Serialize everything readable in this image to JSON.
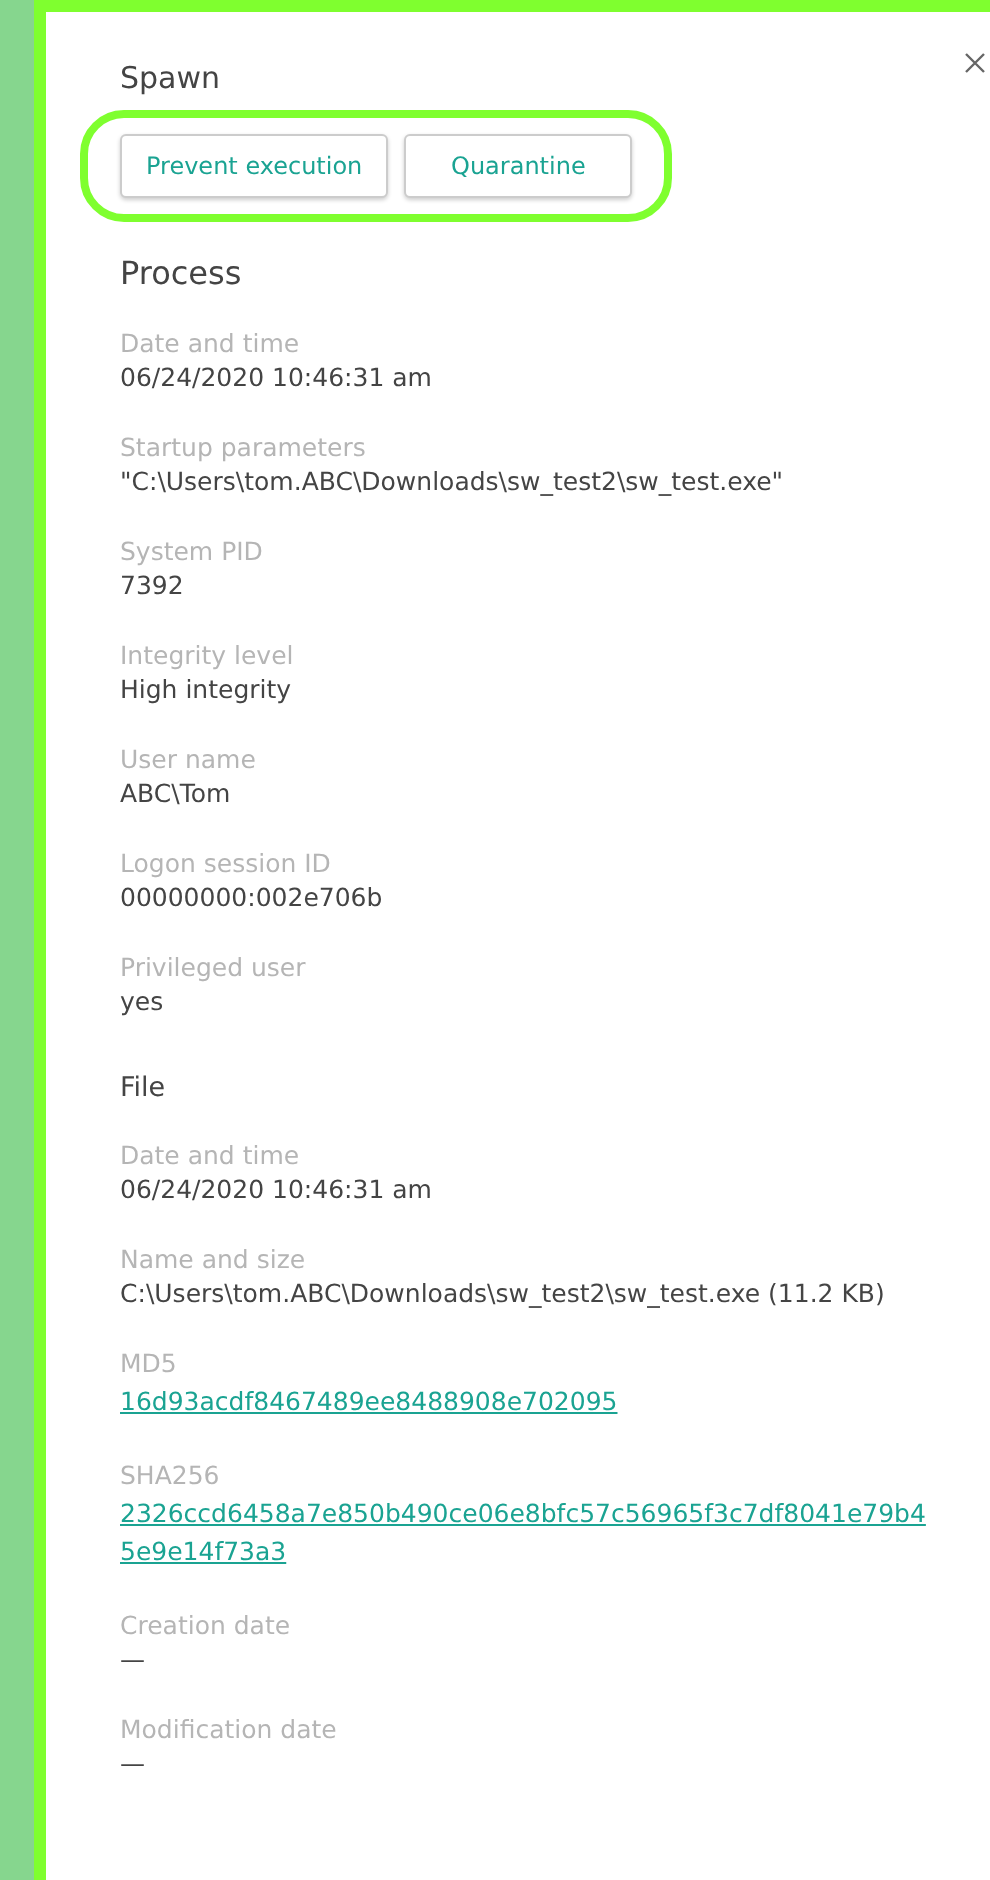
{
  "title": "Spawn",
  "actions": [
    {
      "label": "Prevent execution"
    },
    {
      "label": "Quarantine"
    }
  ],
  "sections": [
    {
      "heading": "Process",
      "kind": "large",
      "fields": [
        {
          "label": "Date and time",
          "value": "06/24/2020 10:46:31 am",
          "kind": "text"
        },
        {
          "label": "Startup parameters",
          "value": "\"C:\\Users\\tom.ABC\\Downloads\\sw_test2\\sw_test.exe\"",
          "kind": "text"
        },
        {
          "label": "System PID",
          "value": "7392",
          "kind": "text"
        },
        {
          "label": "Integrity level",
          "value": "High integrity",
          "kind": "text"
        },
        {
          "label": "User name",
          "value": "ABC\\Tom",
          "kind": "text"
        },
        {
          "label": "Logon session ID",
          "value": "00000000:002e706b",
          "kind": "text"
        },
        {
          "label": "Privileged user",
          "value": "yes",
          "kind": "text"
        }
      ]
    },
    {
      "heading": "File",
      "kind": "small",
      "fields": [
        {
          "label": "Date and time",
          "value": "06/24/2020 10:46:31 am",
          "kind": "text"
        },
        {
          "label": "Name and size",
          "value": "C:\\Users\\tom.ABC\\Downloads\\sw_test2\\sw_test.exe (11.2 KB)",
          "kind": "text"
        },
        {
          "label": "MD5",
          "value": "16d93acdf8467489ee8488908e702095",
          "kind": "link"
        },
        {
          "label": "SHA256",
          "value": "2326ccd6458a7e850b490ce06e8bfc57c56965f3c7df8041e79b45e9e14f73a3",
          "kind": "link"
        },
        {
          "label": "Creation date",
          "value": "—",
          "kind": "text"
        },
        {
          "label": "Modification date",
          "value": "—",
          "kind": "text"
        }
      ]
    }
  ]
}
